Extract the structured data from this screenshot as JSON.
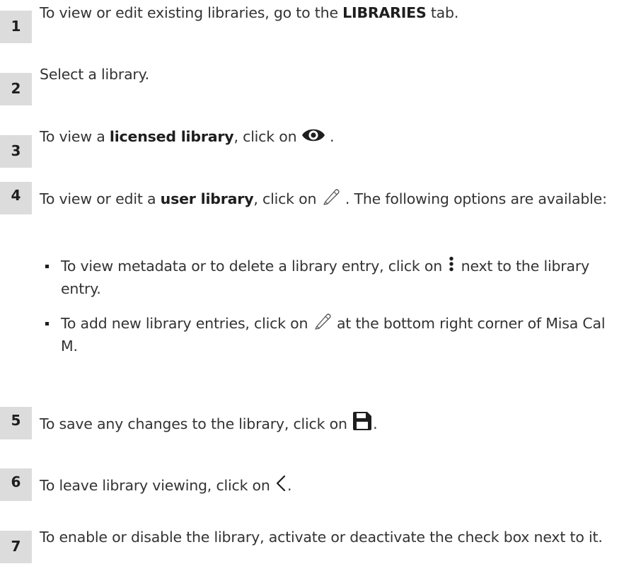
{
  "steps": [
    {
      "number": "1",
      "before": "To view or edit existing libraries, go to the ",
      "bold": "LIBRARIES",
      "after": " tab."
    },
    {
      "number": "2",
      "text": "Select a library."
    },
    {
      "number": "3",
      "before": "To view a ",
      "bold": "licensed library",
      "middle": ", click on ",
      "icon": "eye-icon",
      "after": " ."
    },
    {
      "number": "4",
      "before": "To view or edit a ",
      "bold": "user library",
      "middle": ", click on ",
      "icon": "pencil-icon",
      "after": " . The following options are available:",
      "bullets": [
        {
          "before": "To view metadata or to delete a library entry, click on ",
          "icon": "vertical-dots-icon",
          "after": " next to the library entry."
        },
        {
          "before": "To add new library entries, click on ",
          "icon": "pencil-icon",
          "after": " at the bottom right corner of Misa Cal M."
        }
      ]
    },
    {
      "number": "5",
      "before": "To save any changes to the library, click on ",
      "icon": "save-icon",
      "after": "."
    },
    {
      "number": "6",
      "before": "To leave library viewing, click on ",
      "icon": "chevron-left-icon",
      "after": "."
    },
    {
      "number": "7",
      "text": "To enable or disable the library, activate or deactivate the check box next to it."
    }
  ]
}
